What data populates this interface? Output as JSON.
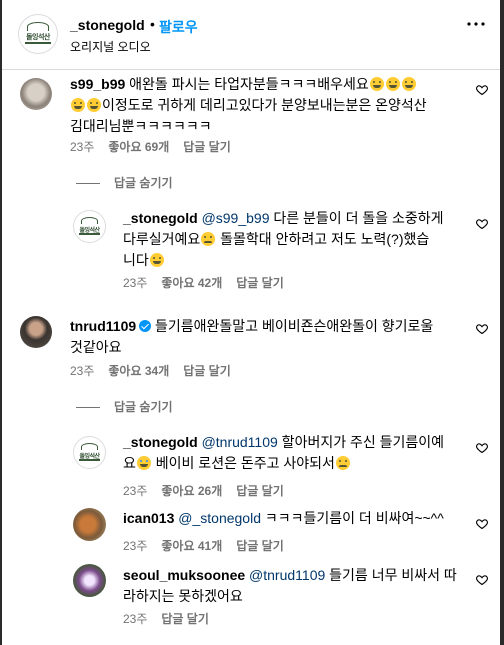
{
  "header": {
    "username": "_stonegold",
    "dot": "•",
    "follow_label": "팔로우",
    "subtitle": "오리지널 오디오",
    "logo_text": "돌잉석산"
  },
  "comments": [
    {
      "username": "s99_b99",
      "text": "애완돌 파시는 타업자분들ㅋㅋㅋ배우세요",
      "text2": "이정도로 귀하게 데리고있다가 분양보내는분은 온양석산",
      "text3": "김대리님뿐ㅋㅋㅋㅋㅋㅋ",
      "time": "23주",
      "likes": "좋아요 69개",
      "reply": "답글 달기",
      "toggle": "답글 숨기기"
    },
    {
      "username": "_stonegold",
      "mention": "@s99_b99",
      "text": " 다른 분들이 더 돌을 소중하게",
      "text2": "다루실거예요",
      "text3": " 돌몰학대 안하려고 저도 노력(?)했습",
      "text4": "니다",
      "time": "23주",
      "likes": "좋아요 42개",
      "reply": "답글 달기"
    },
    {
      "username": "tnrud1109",
      "text": " 들기름애완돌말고 베이비죤슨애완돌이 향기로울",
      "text2": "것같아요",
      "time": "23주",
      "likes": "좋아요 34개",
      "reply": "답글 달기",
      "toggle": "답글 숨기기"
    },
    {
      "username": "_stonegold",
      "mention": "@tnrud1109",
      "text": " 할아버지가 주신 들기름이예",
      "text2": "요",
      "text3": " 베이비 로션은 돈주고 사야되서",
      "time": "23주",
      "likes": "좋아요 26개",
      "reply": "답글 달기"
    },
    {
      "username": "ican013",
      "mention": "@_stonegold",
      "text": " ㅋㅋㅋ들기름이 더 비싸여~~^^",
      "time": "23주",
      "likes": "좋아요 41개",
      "reply": "답글 달기"
    },
    {
      "username": "seoul_muksoonee",
      "mention": "@tnrud1109",
      "text": " 들기름 너무 비싸서 따",
      "text2": "라하지는 못하겠어요",
      "time": "23주",
      "reply": "답글 달기"
    }
  ]
}
